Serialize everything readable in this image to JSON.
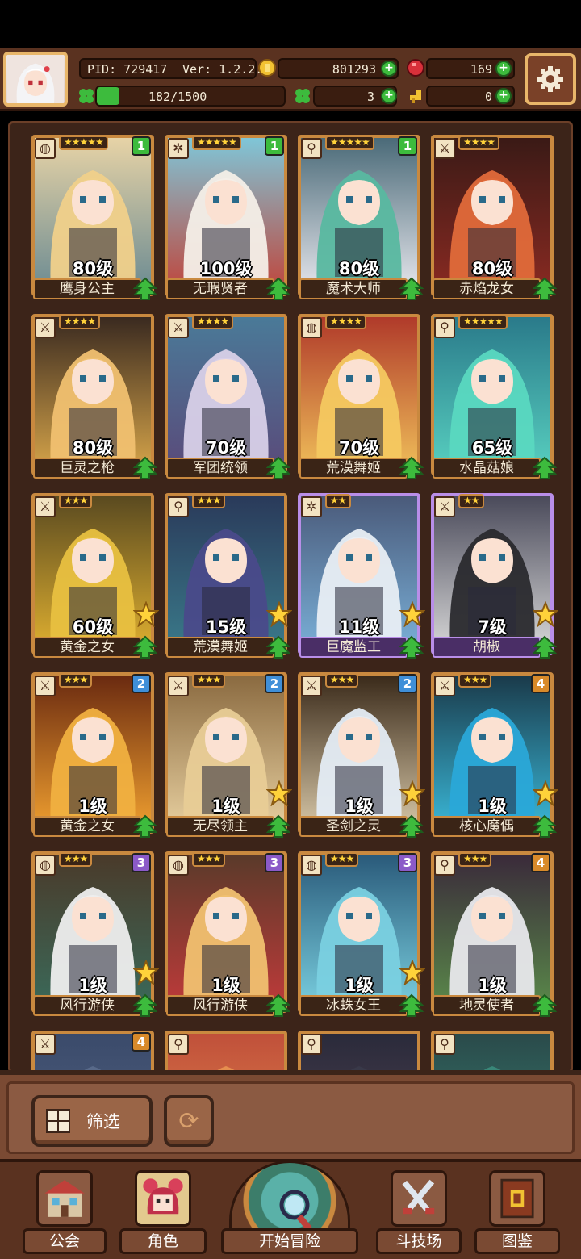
{
  "header": {
    "pid": "PID: 729417",
    "version": "Ver: 1.2.2.0",
    "energy": "182/1500",
    "energy_fraction": 0.121,
    "gold": "801293",
    "gems": "169",
    "clover": "3",
    "key": "0"
  },
  "colors": {
    "rarity_gold": "#c9893f",
    "rarity_purple": "#b98ee8",
    "badge_green": "#3dbb3d",
    "badge_blue": "#3f8fd8",
    "badge_purple": "#8b5ac8",
    "badge_orange": "#d88a2a"
  },
  "cards": [
    {
      "name": "鹰身公主",
      "level": "80级",
      "stars": "★★★★★",
      "badge": "1",
      "badge_color": "green",
      "type": "rune-icon",
      "rarity": "gold",
      "bg": [
        "#e7d3a6",
        "#6a8a92"
      ],
      "hair": "#f0d08a",
      "star_icon": false
    },
    {
      "name": "无瑕贤者",
      "level": "100级",
      "stars": "★★★★★",
      "badge": "1",
      "badge_color": "green",
      "type": "gear-icon",
      "rarity": "gold",
      "bg": [
        "#7fc6d8",
        "#c0443a"
      ],
      "hair": "#f4efe8",
      "star_icon": false
    },
    {
      "name": "魔术大师",
      "level": "80级",
      "stars": "★★★★★",
      "badge": "1",
      "badge_color": "green",
      "type": "wand-icon",
      "rarity": "gold",
      "bg": [
        "#4a6a78",
        "#e8e8ee"
      ],
      "hair": "#58b8a0",
      "star_icon": false
    },
    {
      "name": "赤焰龙女",
      "level": "80级",
      "stars": "★★★★",
      "badge": "",
      "badge_color": "",
      "type": "sword-icon",
      "rarity": "gold",
      "bg": [
        "#3a1a16",
        "#8a2a22"
      ],
      "hair": "#e06a3a",
      "star_icon": false
    },
    {
      "name": "巨灵之枪",
      "level": "80级",
      "stars": "★★★★",
      "badge": "",
      "badge_color": "",
      "type": "sword-icon",
      "rarity": "gold",
      "bg": [
        "#3a2a20",
        "#d8a64a"
      ],
      "hair": "#f0c070",
      "star_icon": false
    },
    {
      "name": "军团统领",
      "level": "70级",
      "stars": "★★★★",
      "badge": "",
      "badge_color": "",
      "type": "sword-icon",
      "rarity": "gold",
      "bg": [
        "#4a7a98",
        "#5a4a7a"
      ],
      "hair": "#d8d0e8",
      "star_icon": false
    },
    {
      "name": "荒漠舞姬",
      "level": "70级",
      "stars": "★★★★",
      "badge": "",
      "badge_color": "",
      "type": "rune-icon",
      "rarity": "gold",
      "bg": [
        "#b03a2a",
        "#f0c05a"
      ],
      "hair": "#f4c860",
      "star_icon": false
    },
    {
      "name": "水晶菇娘",
      "level": "65级",
      "stars": "★★★★★",
      "badge": "",
      "badge_color": "",
      "type": "wand-icon",
      "rarity": "gold",
      "bg": [
        "#2a7a8a",
        "#58d0c0"
      ],
      "hair": "#5ad8c0",
      "star_icon": false
    },
    {
      "name": "黄金之女",
      "level": "60级",
      "stars": "★★★",
      "badge": "",
      "badge_color": "",
      "type": "sword-icon",
      "rarity": "gold",
      "bg": [
        "#5a4a20",
        "#e0b030"
      ],
      "hair": "#e8c040",
      "star_icon": true
    },
    {
      "name": "荒漠舞姬",
      "level": "15级",
      "stars": "★★★",
      "badge": "",
      "badge_color": "",
      "type": "wand-icon",
      "rarity": "gold",
      "bg": [
        "#2a3a5a",
        "#3a7a8a"
      ],
      "hair": "#4a4a8a",
      "star_icon": true
    },
    {
      "name": "巨魔监工",
      "level": "11级",
      "stars": "★★",
      "badge": "",
      "badge_color": "",
      "type": "gear-icon",
      "rarity": "purple",
      "bg": [
        "#4a5a7a",
        "#7ab0d8"
      ],
      "hair": "#e8eef4",
      "star_icon": true
    },
    {
      "name": "胡椒",
      "level": "7级",
      "stars": "★★",
      "badge": "",
      "badge_color": "",
      "type": "sword-icon",
      "rarity": "purple",
      "bg": [
        "#4a4a5a",
        "#d8d8d8"
      ],
      "hair": "#2a2a2e",
      "star_icon": true
    },
    {
      "name": "黄金之女",
      "level": "1级",
      "stars": "★★★",
      "badge": "2",
      "badge_color": "blue",
      "type": "sword-icon",
      "rarity": "gold",
      "bg": [
        "#6a2a10",
        "#f0a030"
      ],
      "hair": "#f0b040",
      "star_icon": false
    },
    {
      "name": "无尽领主",
      "level": "1级",
      "stars": "★★★",
      "badge": "2",
      "badge_color": "blue",
      "type": "sword-icon",
      "rarity": "gold",
      "bg": [
        "#8a6a40",
        "#e8d0a0"
      ],
      "hair": "#e8cc96",
      "star_icon": true
    },
    {
      "name": "圣剑之灵",
      "level": "1级",
      "stars": "★★★",
      "badge": "2",
      "badge_color": "blue",
      "type": "sword-icon",
      "rarity": "gold",
      "bg": [
        "#3a2a1a",
        "#d8c8a8"
      ],
      "hair": "#e4ecf4",
      "star_icon": true
    },
    {
      "name": "核心魔偶",
      "level": "1级",
      "stars": "★★★",
      "badge": "4",
      "badge_color": "orange",
      "type": "sword-icon",
      "rarity": "gold",
      "bg": [
        "#1a3a4a",
        "#3ab8d8"
      ],
      "hair": "#2aa8d8",
      "star_icon": true
    },
    {
      "name": "风行游侠",
      "level": "1级",
      "stars": "★★★",
      "badge": "3",
      "badge_color": "purple",
      "type": "rune-icon",
      "rarity": "gold",
      "bg": [
        "#4a3a2a",
        "#3a6a5a"
      ],
      "hair": "#eeeeee",
      "star_icon": true
    },
    {
      "name": "风行游侠",
      "level": "1级",
      "stars": "★★★",
      "badge": "3",
      "badge_color": "purple",
      "type": "rune-icon",
      "rarity": "gold",
      "bg": [
        "#5a3a2a",
        "#c03a3a"
      ],
      "hair": "#f0c070",
      "star_icon": false
    },
    {
      "name": "冰蛛女王",
      "level": "1级",
      "stars": "★★★",
      "badge": "3",
      "badge_color": "purple",
      "type": "rune-icon",
      "rarity": "gold",
      "bg": [
        "#2a5a7a",
        "#7ad0e0"
      ],
      "hair": "#7ad0e0",
      "star_icon": true
    },
    {
      "name": "地灵使者",
      "level": "1级",
      "stars": "★★★",
      "badge": "4",
      "badge_color": "orange",
      "type": "wand-icon",
      "rarity": "gold",
      "bg": [
        "#3a2a3a",
        "#5a8a4a"
      ],
      "hair": "#e8e8ec",
      "star_icon": false
    },
    {
      "name": "",
      "level": "",
      "stars": "",
      "badge": "4",
      "badge_color": "orange",
      "type": "sword-icon",
      "rarity": "gold",
      "bg": [
        "#3a4a6a",
        "#5a6a8a"
      ],
      "hair": "#5a6a8a",
      "star_icon": false
    },
    {
      "name": "",
      "level": "",
      "stars": "",
      "badge": "",
      "badge_color": "",
      "type": "wand-icon",
      "rarity": "gold",
      "bg": [
        "#c0503a",
        "#e89050"
      ],
      "hair": "#e89050",
      "star_icon": false
    },
    {
      "name": "",
      "level": "",
      "stars": "",
      "badge": "",
      "badge_color": "",
      "type": "wand-icon",
      "rarity": "gold",
      "bg": [
        "#2a2a3a",
        "#5a4a5a"
      ],
      "hair": "#3a3a4a",
      "star_icon": false
    },
    {
      "name": "",
      "level": "",
      "stars": "",
      "badge": "",
      "badge_color": "",
      "type": "wand-icon",
      "rarity": "gold",
      "bg": [
        "#2a4a4a",
        "#3a8a7a"
      ],
      "hair": "#3a8a7a",
      "star_icon": false
    }
  ],
  "filter": {
    "label": "筛选"
  },
  "nav": {
    "guild": "公会",
    "character": "角色",
    "adventure": "开始冒险",
    "arena": "斗技场",
    "codex": "图鉴"
  }
}
